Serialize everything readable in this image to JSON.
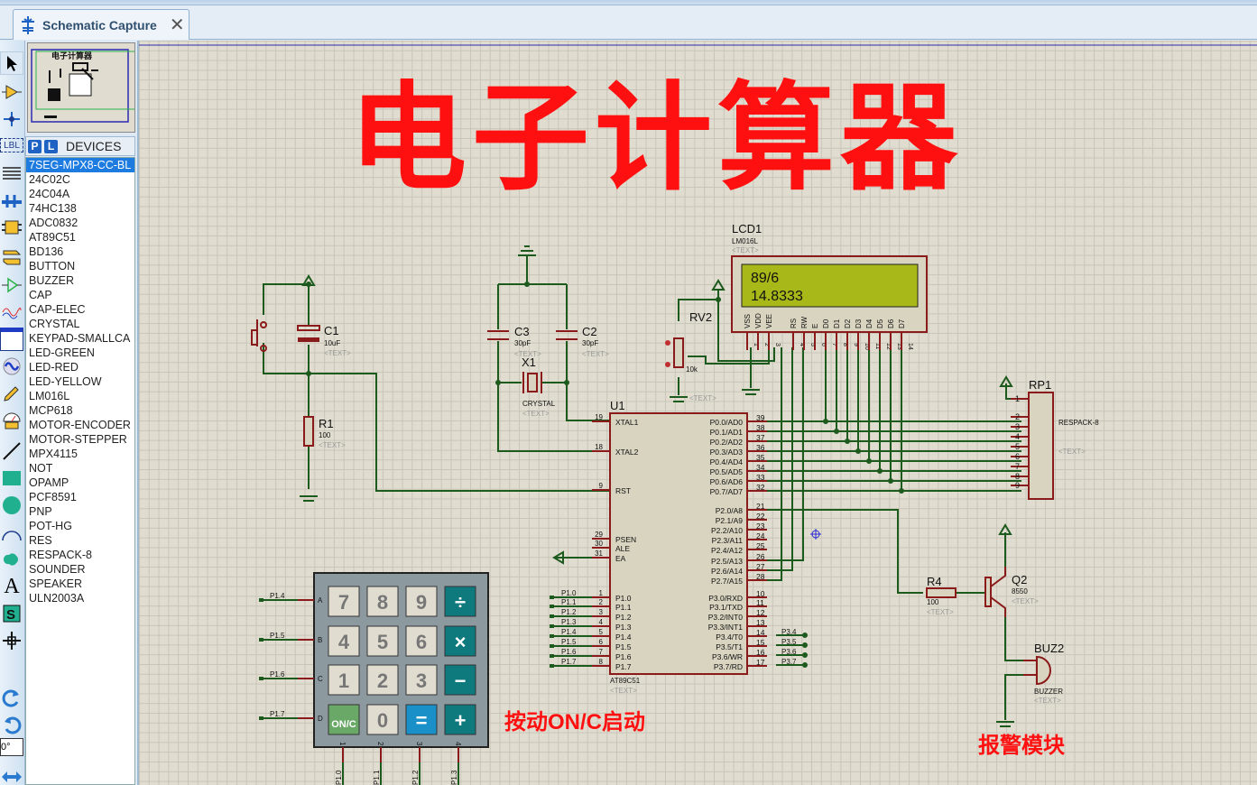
{
  "tab": {
    "label": "Schematic Capture",
    "close": "✕"
  },
  "toolbox": {
    "tools": [
      "selection-mode",
      "component-mode",
      "junction-mode",
      "wire-label-mode",
      "text-script-mode",
      "buses-mode",
      "subcircuit-mode",
      "terminals-mode",
      "device-pins-mode",
      "graph-mode",
      "tape-recorder-mode",
      "generator-mode",
      "voltage-probe-mode",
      "virtual-instruments-mode",
      "2d-line",
      "2d-box",
      "2d-circle",
      "2d-arc",
      "2d-path",
      "2d-text",
      "2d-symbol",
      "2d-marker",
      "rotate-cw",
      "rotate-ccw",
      "angle",
      "mirror"
    ],
    "lbl": "LBL",
    "angle_value": "0°"
  },
  "overview": {
    "title": "电子计算器"
  },
  "devices": {
    "p_button": "P",
    "l_button": "L",
    "title": "DEVICES",
    "items": [
      "7SEG-MPX8-CC-BL",
      "24C02C",
      "24C04A",
      "74HC138",
      "ADC0832",
      "AT89C51",
      "BD136",
      "BUTTON",
      "BUZZER",
      "CAP",
      "CAP-ELEC",
      "CRYSTAL",
      "KEYPAD-SMALLCA",
      "LED-GREEN",
      "LED-RED",
      "LED-YELLOW",
      "LM016L",
      "MCP618",
      "MOTOR-ENCODER",
      "MOTOR-STEPPER",
      "MPX4115",
      "NOT",
      "OPAMP",
      "PCF8591",
      "PNP",
      "POT-HG",
      "RES",
      "RESPACK-8",
      "SOUNDER",
      "SPEAKER",
      "ULN2003A"
    ],
    "selected": 0
  },
  "schematic": {
    "title": "电子计算器",
    "note_start": "按动ON/C启动",
    "note_alarm": "报警模块",
    "text_placeholder": "<TEXT>",
    "lcd": {
      "ref": "LCD1",
      "part": "LM016L",
      "line1": "89/6",
      "line2": "14.8333",
      "pins": [
        "VSS",
        "VDD",
        "VEE",
        "RS",
        "RW",
        "E",
        "D0",
        "D1",
        "D2",
        "D3",
        "D4",
        "D5",
        "D6",
        "D7"
      ],
      "pin_numbers": [
        "1",
        "2",
        "3",
        "4",
        "5",
        "6",
        "7",
        "8",
        "9",
        "10",
        "11",
        "12",
        "13",
        "14"
      ]
    },
    "c1": {
      "ref": "C1",
      "value": "10uF"
    },
    "r1": {
      "ref": "R1",
      "value": "100"
    },
    "c3": {
      "ref": "C3",
      "value": "30pF"
    },
    "c2": {
      "ref": "C2",
      "value": "30pF"
    },
    "x1": {
      "ref": "X1",
      "value": "CRYSTAL"
    },
    "rv2": {
      "ref": "RV2",
      "value": "10k"
    },
    "u1": {
      "ref": "U1",
      "part": "AT89C51",
      "left_pins": [
        {
          "n": "19",
          "name": "XTAL1"
        },
        {
          "n": "18",
          "name": "XTAL2"
        },
        {
          "n": "9",
          "name": "RST"
        },
        {
          "n": "29",
          "name": "PSEN"
        },
        {
          "n": "30",
          "name": "ALE"
        },
        {
          "n": "31",
          "name": "EA"
        },
        {
          "n": "1",
          "name": "P1.0"
        },
        {
          "n": "2",
          "name": "P1.1"
        },
        {
          "n": "3",
          "name": "P1.2"
        },
        {
          "n": "4",
          "name": "P1.3"
        },
        {
          "n": "5",
          "name": "P1.4"
        },
        {
          "n": "6",
          "name": "P1.5"
        },
        {
          "n": "7",
          "name": "P1.6"
        },
        {
          "n": "8",
          "name": "P1.7"
        }
      ],
      "right_pins": [
        {
          "n": "39",
          "name": "P0.0/AD0"
        },
        {
          "n": "38",
          "name": "P0.1/AD1"
        },
        {
          "n": "37",
          "name": "P0.2/AD2"
        },
        {
          "n": "36",
          "name": "P0.3/AD3"
        },
        {
          "n": "35",
          "name": "P0.4/AD4"
        },
        {
          "n": "34",
          "name": "P0.5/AD5"
        },
        {
          "n": "33",
          "name": "P0.6/AD6"
        },
        {
          "n": "32",
          "name": "P0.7/AD7"
        },
        {
          "n": "21",
          "name": "P2.0/A8"
        },
        {
          "n": "22",
          "name": "P2.1/A9"
        },
        {
          "n": "23",
          "name": "P2.2/A10"
        },
        {
          "n": "24",
          "name": "P2.3/A11"
        },
        {
          "n": "25",
          "name": "P2.4/A12"
        },
        {
          "n": "26",
          "name": "P2.5/A13"
        },
        {
          "n": "27",
          "name": "P2.6/A14"
        },
        {
          "n": "28",
          "name": "P2.7/A15"
        },
        {
          "n": "10",
          "name": "P3.0/RXD"
        },
        {
          "n": "11",
          "name": "P3.1/TXD"
        },
        {
          "n": "12",
          "name": "P3.2/INT0"
        },
        {
          "n": "13",
          "name": "P3.3/INT1"
        },
        {
          "n": "14",
          "name": "P3.4/T0"
        },
        {
          "n": "15",
          "name": "P3.5/T1"
        },
        {
          "n": "16",
          "name": "P3.6/WR"
        },
        {
          "n": "17",
          "name": "P3.7/RD"
        }
      ],
      "p1_labels": [
        "P1.0",
        "P1.1",
        "P1.2",
        "P1.3",
        "P1.4",
        "P1.5",
        "P1.6",
        "P1.7"
      ],
      "p3_labels": [
        "P3.4",
        "P3.5",
        "P3.6",
        "P3.7"
      ]
    },
    "rp1": {
      "ref": "RP1",
      "part": "RESPACK-8",
      "pins": [
        "1",
        "2",
        "3",
        "4",
        "5",
        "6",
        "7",
        "8",
        "9"
      ]
    },
    "r4": {
      "ref": "R4",
      "value": "100"
    },
    "q2": {
      "ref": "Q2",
      "value": "8550"
    },
    "buz2": {
      "ref": "BUZ2",
      "value": "BUZZER"
    },
    "keypad": {
      "rows": [
        "A",
        "B",
        "C",
        "D"
      ],
      "row_nets": [
        "P1.4",
        "P1.5",
        "P1.6",
        "P1.7"
      ],
      "cols": [
        "1",
        "2",
        "3",
        "4"
      ],
      "col_nets": [
        "P1.0",
        "P1.1",
        "P1.2",
        "P1.3"
      ],
      "keys": [
        [
          "7",
          "8",
          "9",
          "÷"
        ],
        [
          "4",
          "5",
          "6",
          "×"
        ],
        [
          "1",
          "2",
          "3",
          "−"
        ],
        [
          "ON/C",
          "0",
          "=",
          "+"
        ]
      ]
    }
  }
}
